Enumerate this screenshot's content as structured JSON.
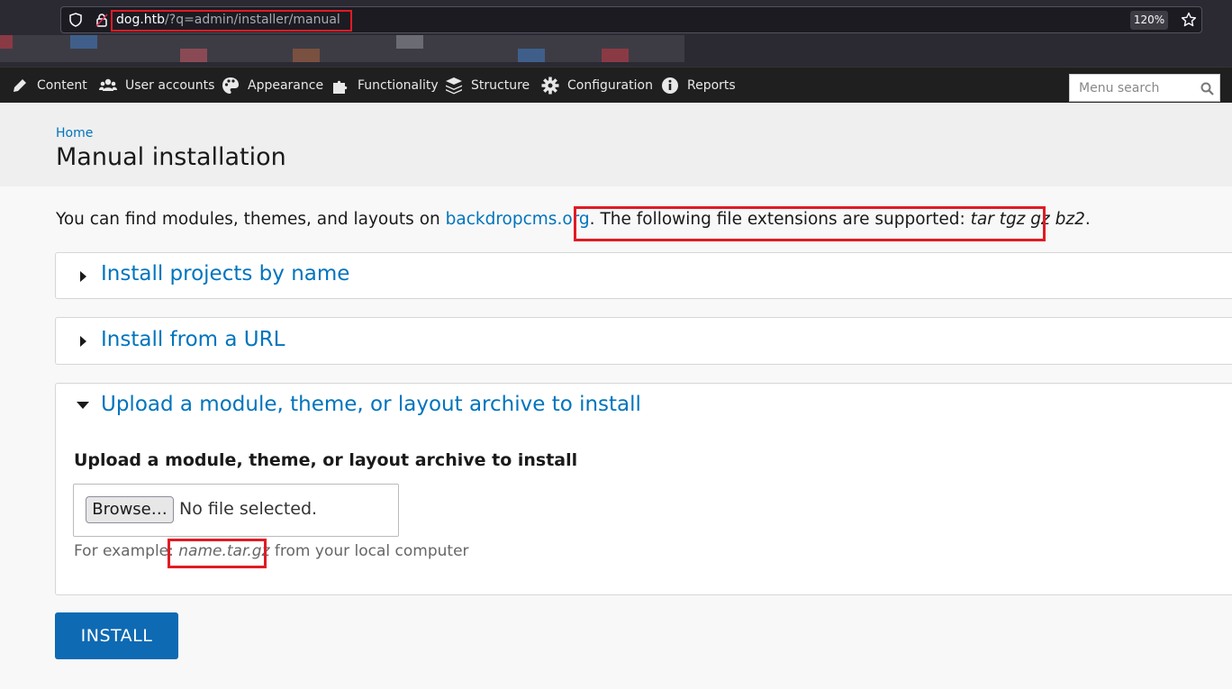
{
  "browser": {
    "url_host": "dog.htb",
    "url_path": "/?q=admin/installer/manual",
    "zoom": "120%",
    "icons": [
      "shield-icon",
      "lock-icon",
      "star-icon"
    ]
  },
  "admin_bar": {
    "items": [
      {
        "label": "Content",
        "icon": "pencil-icon"
      },
      {
        "label": "User accounts",
        "icon": "users-icon"
      },
      {
        "label": "Appearance",
        "icon": "palette-icon"
      },
      {
        "label": "Functionality",
        "icon": "puzzle-icon"
      },
      {
        "label": "Structure",
        "icon": "layers-icon"
      },
      {
        "label": "Configuration",
        "icon": "gear-icon"
      },
      {
        "label": "Reports",
        "icon": "info-icon"
      }
    ],
    "search_placeholder": "Menu search"
  },
  "header": {
    "breadcrumb": "Home",
    "title": "Manual installation"
  },
  "intro": {
    "prefix": "You can find modules, themes, and layouts on ",
    "link": "backdropcms.org",
    "period": ".",
    "supported_prefix": " The following file extensions are supported: ",
    "extensions": "tar tgz gz bz2",
    "supported_suffix": "."
  },
  "fieldsets": [
    {
      "legend": "Install projects by name",
      "expanded": false
    },
    {
      "legend": "Install from a URL",
      "expanded": false
    },
    {
      "legend": "Upload a module, theme, or layout archive to install",
      "expanded": true
    }
  ],
  "upload": {
    "label": "Upload a module, theme, or layout archive to install",
    "browse_label": "Browse…",
    "file_status": "No file selected.",
    "desc_prefix": "For example: ",
    "desc_example": "name.tar.gz",
    "desc_suffix": " from your local computer"
  },
  "install_label": "INSTALL",
  "colors": {
    "link": "#0074bd",
    "button": "#0e6ab3",
    "highlight": "#e01b24"
  }
}
